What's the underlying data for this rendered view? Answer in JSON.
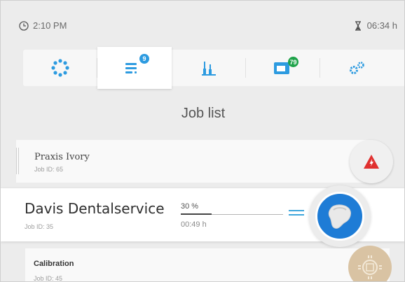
{
  "status": {
    "time": "2:10 PM",
    "timer": "06:34 h",
    "clock_icon": "clock-icon",
    "timer_icon": "hourglass-icon"
  },
  "tabs": [
    {
      "name": "tab-dashboard",
      "icon": "dots-ring-icon",
      "badge": ""
    },
    {
      "name": "tab-job-list",
      "icon": "job-list-icon",
      "badge": "9"
    },
    {
      "name": "tab-tools",
      "icon": "milling-tools-icon",
      "badge": ""
    },
    {
      "name": "tab-material",
      "icon": "material-blank-icon",
      "badge": "79"
    },
    {
      "name": "tab-settings",
      "icon": "gears-icon",
      "badge": ""
    }
  ],
  "colors": {
    "accent": "#2d9be0",
    "badge": "#2d9be0",
    "badge_green": "#1fa34a",
    "alert": "#e0302f",
    "tooth_blue": "#1e7cd6"
  },
  "page_title": "Job list",
  "jobs": [
    {
      "name": "Praxis Ivory",
      "id": "Job ID: 65",
      "status_icon": "warning-icon"
    },
    {
      "name": "Davis Dentalservice",
      "id": "Job ID: 35",
      "progress_label": "30 %",
      "progress": 0.3,
      "time": "00:49 h",
      "status_icon": "tooth-icon"
    },
    {
      "name": "Calibration",
      "id": "Job ID: 45",
      "status_icon": "calibration-icon"
    }
  ]
}
